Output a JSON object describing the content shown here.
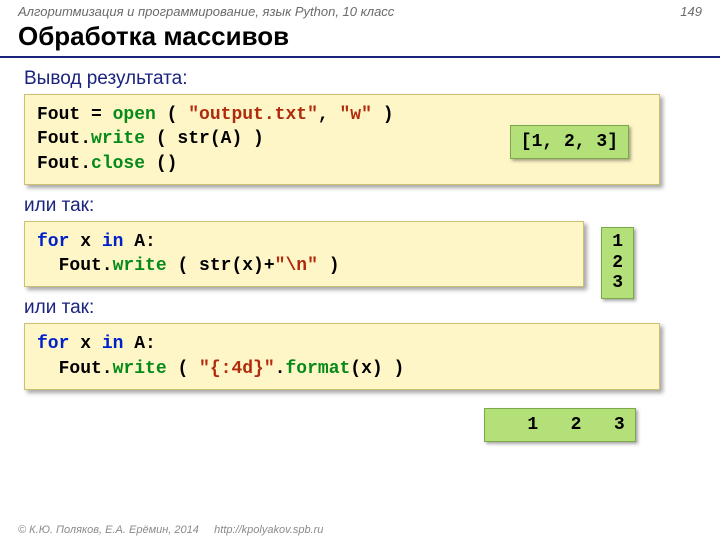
{
  "header": {
    "course": "Алгоритмизация и программирование, язык Python, 10 класс",
    "page_number": "149"
  },
  "title": "Обработка массивов",
  "sections": {
    "s1": {
      "heading": "Вывод результата:",
      "code": {
        "l1a": "Fout = ",
        "l1b": "open",
        "l1c": " ( ",
        "l1d": "\"output.txt\"",
        "l1e": ", ",
        "l1f": "\"w\"",
        "l1g": " )",
        "l2a": "Fout.",
        "l2b": "write",
        "l2c": " ( str(A) )",
        "l3a": "Fout.",
        "l3b": "close",
        "l3c": " ()"
      },
      "output": "[1, 2, 3]"
    },
    "s2": {
      "heading": "или так:",
      "code": {
        "l1a": "for",
        "l1b": " x ",
        "l1c": "in",
        "l1d": " A:",
        "l2a": "  Fout.",
        "l2b": "write",
        "l2c": " ( str(x)+",
        "l2d": "\"\\n\"",
        "l2e": " )"
      },
      "output": "1\n2\n3"
    },
    "s3": {
      "heading": "или так:",
      "code": {
        "l1a": "for",
        "l1b": " x ",
        "l1c": "in",
        "l1d": " A:",
        "l2a": "  Fout.",
        "l2b": "write",
        "l2c": " ( ",
        "l2d": "\"{:4d}\"",
        "l2e": ".",
        "l2f": "format",
        "l2g": "(x) )"
      },
      "output": "   1   2   3"
    }
  },
  "footer": {
    "copyright": "© К.Ю. Поляков, Е.А. Ерёмин, 2014",
    "url": "http://kpolyakov.spb.ru"
  }
}
